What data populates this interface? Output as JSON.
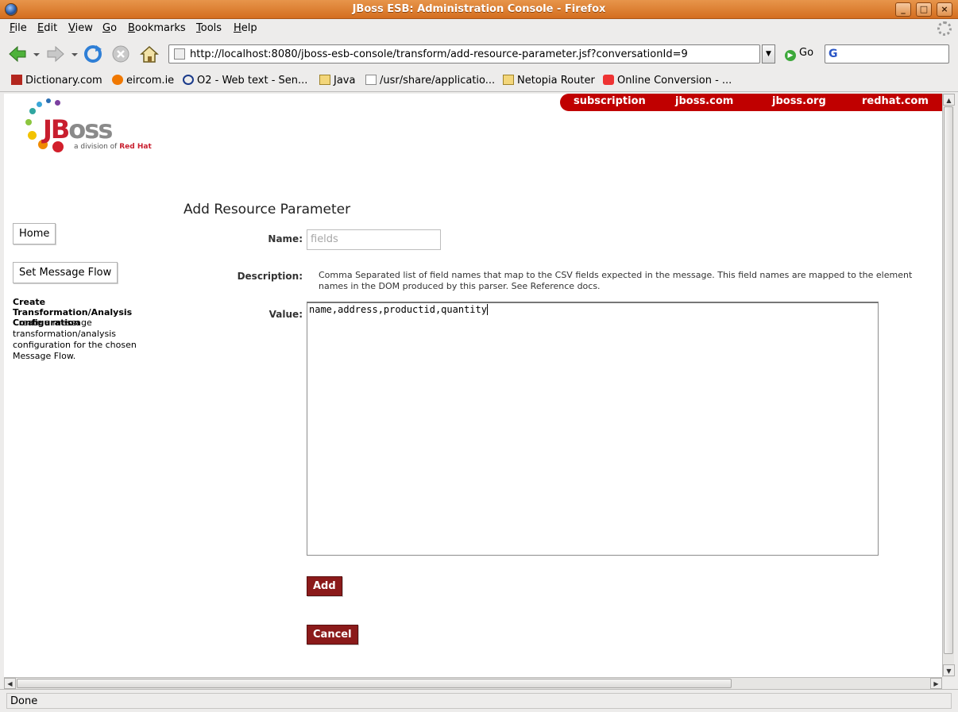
{
  "window": {
    "title": "JBoss ESB: Administration Console - Firefox",
    "controls": [
      "_",
      "□",
      "×"
    ]
  },
  "menu": {
    "items": [
      "File",
      "Edit",
      "View",
      "Go",
      "Bookmarks",
      "Tools",
      "Help"
    ],
    "mnemonics": [
      "F",
      "E",
      "V",
      "G",
      "B",
      "T",
      "H"
    ]
  },
  "nav": {
    "url": "http://localhost:8080/jboss-esb-console/transform/add-resource-parameter.jsf?conversationId=9",
    "go_label": "Go",
    "search_placeholder": "",
    "search_engine_glyph": "G"
  },
  "bookmarks": [
    {
      "label": "Dictionary.com",
      "icon": "dictionary-icon"
    },
    {
      "label": "eircom.ie",
      "icon": "eircom-icon"
    },
    {
      "label": "O2 - Web text - Sen...",
      "icon": "o2-icon"
    },
    {
      "label": "Java",
      "icon": "folder-icon"
    },
    {
      "label": "/usr/share/applicatio...",
      "icon": "file-icon"
    },
    {
      "label": "Netopia Router",
      "icon": "folder-icon"
    },
    {
      "label": "Online Conversion - ...",
      "icon": "conversion-icon"
    }
  ],
  "site": {
    "top_links": [
      "subscription",
      "jboss.com",
      "jboss.org",
      "redhat.com"
    ],
    "logo_text_j": "JB",
    "logo_text_oss": "oss",
    "logo_tagline_prefix": "a division of",
    "logo_tagline_brand": "Red Hat",
    "accent_color": "#c00000",
    "button_color": "#8b1a1a"
  },
  "sidebar": {
    "home_label": "Home",
    "message_flow_label": "Set Message Flow",
    "section_heading": "Create Transformation/Analysis Configuration",
    "section_description": "Create a message transformation/analysis configuration for the chosen Message Flow."
  },
  "form": {
    "heading": "Add Resource Parameter",
    "name_label": "Name:",
    "name_value": "fields",
    "description_label": "Description:",
    "description_text": "Comma Separated list of field names that map to the CSV fields expected in the message. This field names are mapped to the element names in the DOM produced by this parser. See Reference docs.",
    "value_label": "Value:",
    "value_text": "name,address,productid,quantity",
    "add_label": "Add",
    "cancel_label": "Cancel"
  },
  "status": {
    "text": "Done"
  }
}
